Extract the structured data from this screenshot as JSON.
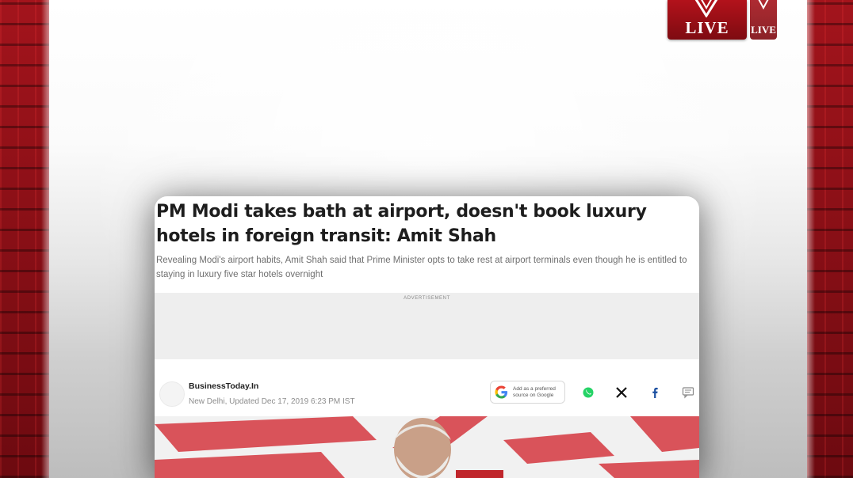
{
  "logo": {
    "main_text": "LIVE",
    "secondary_text": "LIVE",
    "brand_color": "#a6141c"
  },
  "article": {
    "headline": "PM Modi takes bath at airport, doesn't book luxury hotels in foreign transit: Amit Shah",
    "summary": "Revealing Modi's airport habits, Amit Shah said that Prime Minister opts to take rest at airport terminals even though he is entitled to staying in luxury five star hotels overnight",
    "ad_label": "ADVERTISEMENT",
    "publisher": "BusinessToday.In",
    "meta": "New Delhi, Updated Dec 17, 2019 6:23 PM IST",
    "google_button": "Add as a preferred source on Google",
    "share_icons": [
      "whatsapp-icon",
      "x-icon",
      "facebook-icon",
      "comment-icon"
    ]
  },
  "colors": {
    "card_bg": "#ffffff",
    "side_red": "#8b1016",
    "ad_bg": "#eeeeee"
  }
}
